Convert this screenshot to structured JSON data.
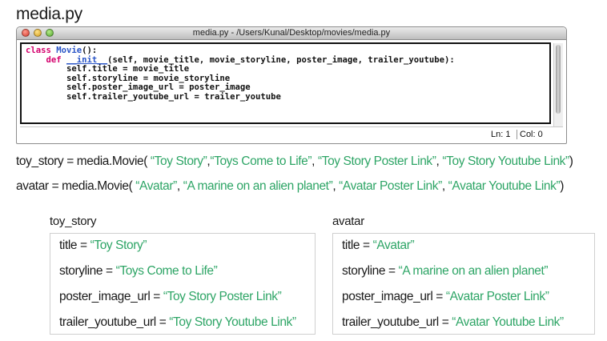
{
  "page_title": "media.py",
  "window": {
    "title": "media.py - /Users/Kunal/Desktop/movies/media.py",
    "status_ln": "Ln: 1",
    "status_col": "Col: 0"
  },
  "code": {
    "l1_kw": "class",
    "l1_name": "Movie",
    "l1_rest": "():",
    "l2_indent": "    ",
    "l2_kw": "def",
    "l2_space": " ",
    "l2_name": "__init__",
    "l2_rest": "(self, movie_title, movie_storyline, poster_image, trailer_youtube):",
    "l3": "        self.title = movie_title",
    "l4": "        self.storyline = movie_storyline",
    "l5": "        self.poster_image_url = poster_image",
    "l6": "        self.trailer_youtube_url = trailer_youtube"
  },
  "statements": {
    "toy_story": {
      "prefix": "toy_story = media.Movie( ",
      "arg1": "“Toy Story”",
      "sep1": ",",
      "arg2": "“Toys Come to Life”",
      "sep2": ", ",
      "arg3": "“Toy Story Poster Link”",
      "sep3": ", ",
      "arg4": "“Toy Story Youtube Link”",
      "suffix": ")"
    },
    "avatar": {
      "prefix": "avatar = media.Movie( ",
      "arg1": "“Avatar”",
      "sep1": ", ",
      "arg2": "“A marine on an alien planet”",
      "sep2": ", ",
      "arg3": "“Avatar Poster Link”",
      "sep3": ", ",
      "arg4": "“Avatar Youtube Link”",
      "suffix": ")"
    }
  },
  "objects": {
    "toy_story": {
      "label": "toy_story",
      "title_key": "title = ",
      "title_val": "“Toy Story”",
      "storyline_key": "storyline = ",
      "storyline_val": "“Toys Come to Life”",
      "poster_key": "poster_image_url = ",
      "poster_val": "“Toy Story Poster Link”",
      "trailer_key": "trailer_youtube_url = ",
      "trailer_val": "“Toy Story Youtube Link”"
    },
    "avatar": {
      "label": "avatar",
      "title_key": "title = ",
      "title_val": "“Avatar”",
      "storyline_key": "storyline = ",
      "storyline_val": "“A marine on an alien planet”",
      "poster_key": "poster_image_url = ",
      "poster_val": "“Avatar Poster Link”",
      "trailer_key": "trailer_youtube_url = ",
      "trailer_val": "“Avatar Youtube Link”"
    }
  },
  "colors": {
    "string_green": "#2ea566",
    "keyword_magenta": "#d4006d",
    "identifier_blue": "#2a55c7"
  }
}
